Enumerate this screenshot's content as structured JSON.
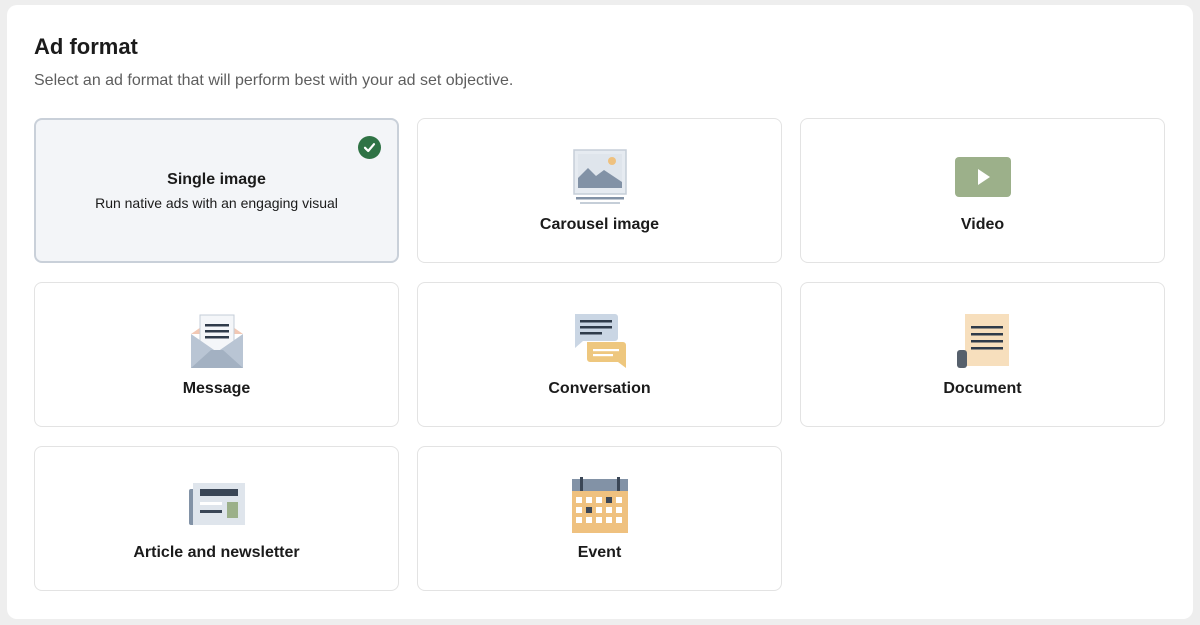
{
  "header": {
    "title": "Ad format",
    "subtitle": "Select an ad format that will perform best with your ad set objective."
  },
  "formats": [
    {
      "label": "Single image",
      "description": "Run native ads with an engaging visual",
      "selected": true,
      "icon": "check-circle-icon"
    },
    {
      "label": "Carousel image",
      "selected": false,
      "icon": "carousel-image-icon"
    },
    {
      "label": "Video",
      "selected": false,
      "icon": "video-play-icon"
    },
    {
      "label": "Message",
      "selected": false,
      "icon": "envelope-icon"
    },
    {
      "label": "Conversation",
      "selected": false,
      "icon": "chat-bubbles-icon"
    },
    {
      "label": "Document",
      "selected": false,
      "icon": "document-icon"
    },
    {
      "label": "Article and newsletter",
      "selected": false,
      "icon": "newspaper-icon"
    },
    {
      "label": "Event",
      "selected": false,
      "icon": "calendar-icon"
    }
  ],
  "colors": {
    "selected_check": "#2f7345",
    "selected_bg": "#f3f5f8",
    "video_icon": "#9cb08a",
    "document_icon": "#f7dfbd",
    "calendar_icon": "#efc17f",
    "chat_bubble": "#eec77e",
    "chat_bubble_alt": "#cad6e4"
  }
}
